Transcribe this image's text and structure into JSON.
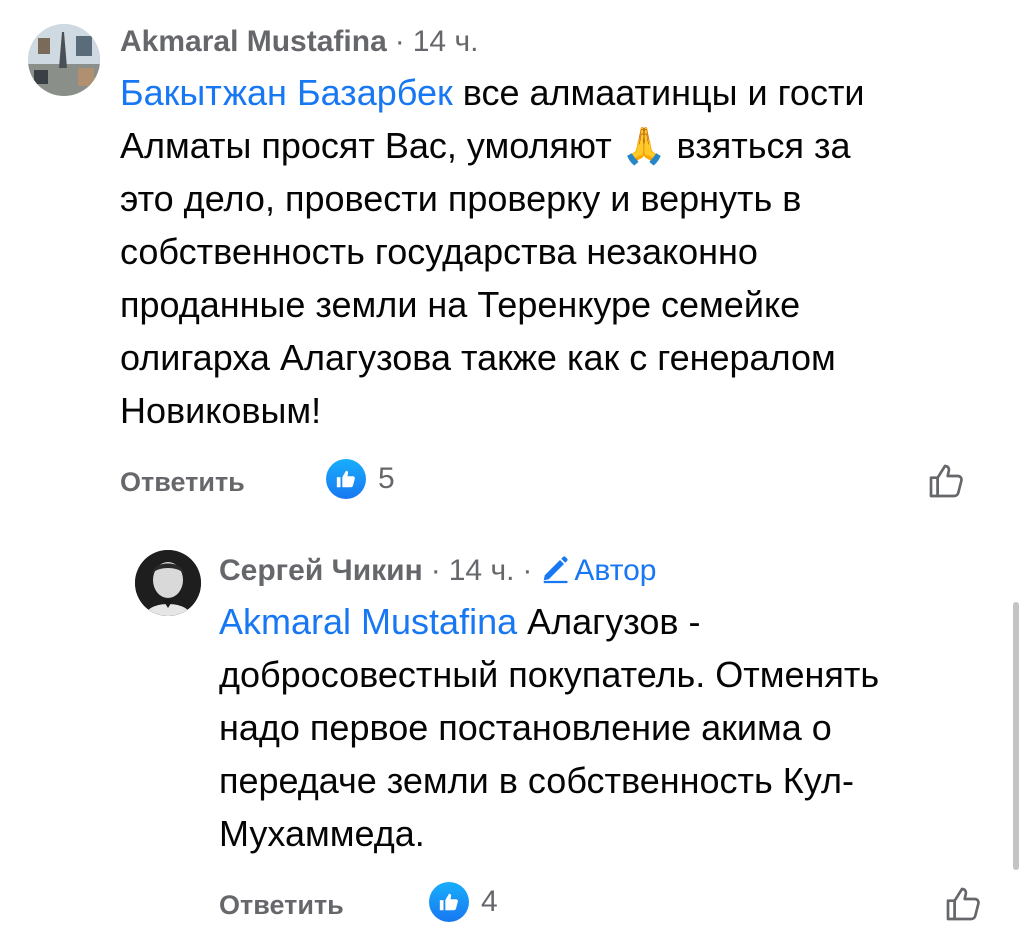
{
  "comments": [
    {
      "author": "Akmaral Mustafina",
      "time": "14 ч.",
      "mention": "Бакытжан Базарбек",
      "lines": [
        " все алмаатинцы и гости",
        "Алматы просят Вас, умоляют ",
        " взяться за",
        "это дело, провести проверку и вернуть в",
        "собственность государства незаконно",
        "проданные земли на Теренкуре семейке",
        "олигарха Алагузова также как с генералом",
        "Новиковым!"
      ],
      "emoji": "🙏",
      "reply_label": "Ответить",
      "like_count": "5"
    },
    {
      "author": "Сергей Чикин",
      "time": "14 ч.",
      "author_badge": "Автор",
      "mention": "Akmaral Mustafina",
      "lines": [
        " Алагузов -",
        "добросовестный покупатель. Отменять",
        "надо первое постановление акима о",
        "передаче земли в собственность Кул-",
        "Мухаммеда."
      ],
      "reply_label": "Ответить",
      "like_count": "4"
    }
  ],
  "separator": "·",
  "colors": {
    "link": "#1877f2",
    "meta": "#65676b",
    "text": "#050505"
  }
}
